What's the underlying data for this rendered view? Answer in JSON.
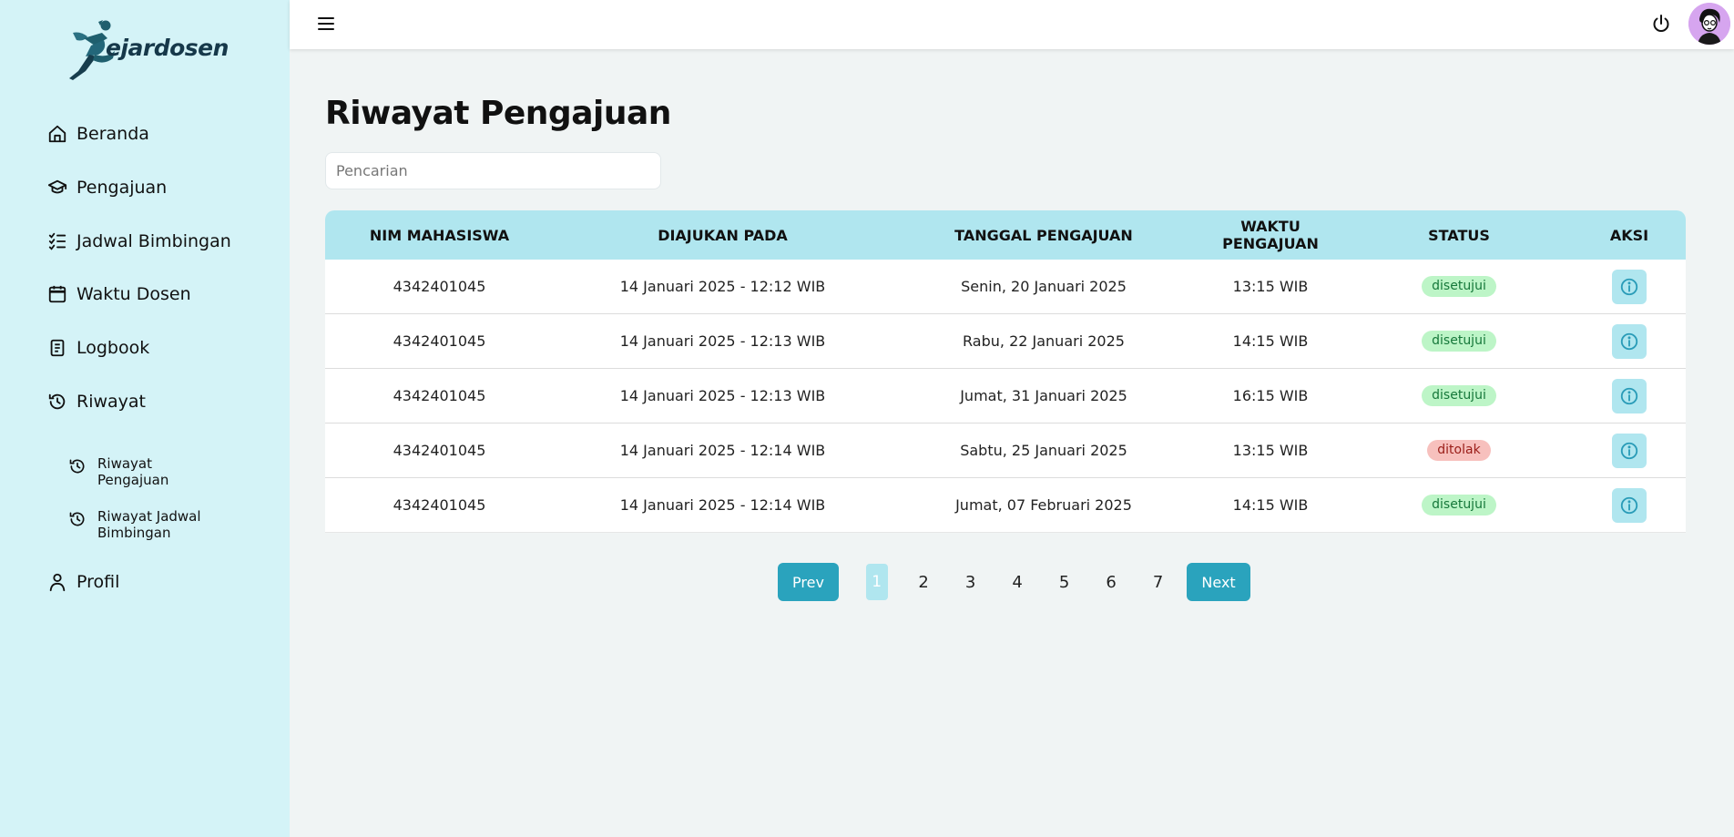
{
  "app": {
    "logo_text": "ejardosen"
  },
  "sidebar": {
    "items": [
      {
        "label": "Beranda",
        "icon": "home-icon"
      },
      {
        "label": "Pengajuan",
        "icon": "graduation-cap-icon"
      },
      {
        "label": "Jadwal Bimbingan",
        "icon": "checklist-icon"
      },
      {
        "label": "Waktu Dosen",
        "icon": "calendar-icon"
      },
      {
        "label": "Logbook",
        "icon": "document-icon"
      },
      {
        "label": "Riwayat",
        "icon": "history-icon"
      }
    ],
    "subitems": [
      {
        "label": "Riwayat Pengajuan",
        "icon": "history-icon"
      },
      {
        "label": "Riwayat Jadwal Bimbingan",
        "icon": "history-icon"
      }
    ],
    "profile": {
      "label": "Profil",
      "icon": "user-icon"
    }
  },
  "header": {
    "menu_icon": "hamburger-icon",
    "power_icon": "power-icon"
  },
  "main": {
    "title": "Riwayat Pengajuan",
    "search_placeholder": "Pencarian",
    "table": {
      "headers": [
        "NIM MAHASISWA",
        "DIAJUKAN PADA",
        "TANGGAL PENGAJUAN",
        "WAKTU PENGAJUAN",
        "STATUS",
        "AKSI"
      ],
      "rows": [
        {
          "nim": "4342401045",
          "diajukan": "14 Januari 2025 - 12:12 WIB",
          "tanggal": "Senin, 20 Januari 2025",
          "waktu": "13:15 WIB",
          "status": "disetujui"
        },
        {
          "nim": "4342401045",
          "diajukan": "14 Januari 2025 - 12:13 WIB",
          "tanggal": "Rabu, 22 Januari 2025",
          "waktu": "14:15 WIB",
          "status": "disetujui"
        },
        {
          "nim": "4342401045",
          "diajukan": "14 Januari 2025 - 12:13 WIB",
          "tanggal": "Jumat, 31 Januari 2025",
          "waktu": "16:15 WIB",
          "status": "disetujui"
        },
        {
          "nim": "4342401045",
          "diajukan": "14 Januari 2025 - 12:14 WIB",
          "tanggal": "Sabtu, 25 Januari 2025",
          "waktu": "13:15 WIB",
          "status": "ditolak"
        },
        {
          "nim": "4342401045",
          "diajukan": "14 Januari 2025 - 12:14 WIB",
          "tanggal": "Jumat, 07 Februari 2025",
          "waktu": "14:15 WIB",
          "status": "disetujui"
        }
      ]
    },
    "pagination": {
      "prev": "Prev",
      "next": "Next",
      "pages": [
        "1",
        "2",
        "3",
        "4",
        "5",
        "6",
        "7"
      ],
      "current": "1"
    }
  },
  "colors": {
    "sidebar_bg": "#d4f3f7",
    "accent": "#2aa3bd",
    "table_header": "#b0e6ef",
    "approved_bg": "#bdf5c7",
    "rejected_bg": "#f7c0bd"
  }
}
